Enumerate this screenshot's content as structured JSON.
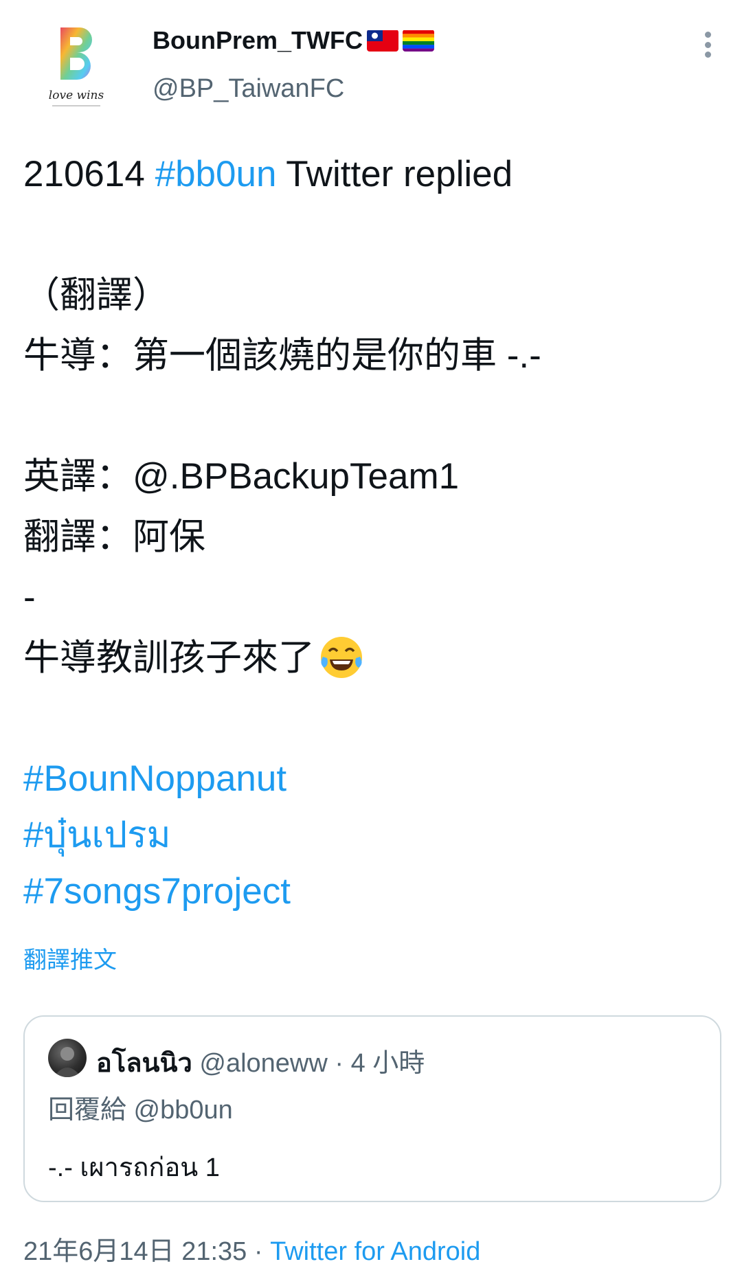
{
  "author": {
    "display_name": "BounPrem_TWFC",
    "flags": [
      "taiwan-flag",
      "rainbow-flag"
    ],
    "handle": "@BP_TaiwanFC",
    "avatar_text": "love wins"
  },
  "tweet": {
    "line1_prefix": "210614 ",
    "line1_hashtag": "#bb0un",
    "line1_suffix": " Twitter replied",
    "line2": "（翻譯）",
    "line3": "牛導：第一個該燒的是你的車 -.-",
    "line4": "英譯：@.BPBackupTeam1",
    "line5": "翻譯：阿保",
    "line6": "-",
    "line7": "牛導教訓孩子來了",
    "line7_emoji": "tears-of-joy-emoji",
    "hashtags": [
      "#BounNoppanut",
      "#บุ๋นเปรม",
      "#7songs7project"
    ]
  },
  "translate_link": "翻譯推文",
  "quote": {
    "name": "อโลนนิว",
    "handle": "@aloneww",
    "separator": " · ",
    "time": "4 小時",
    "reply_to": "回覆給 @bb0un",
    "text": "-.- เผารถก่อน 1"
  },
  "footer": {
    "datetime": "21年6月14日 21:35",
    "separator": " · ",
    "source": "Twitter for Android"
  },
  "colors": {
    "link": "#1d9bf0",
    "secondary_text": "#536471",
    "border": "#cfd9de"
  }
}
